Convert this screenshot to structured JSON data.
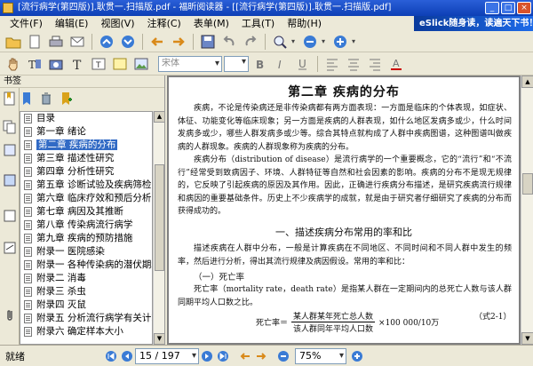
{
  "window": {
    "title": "[流行病学(第四版)].耿贯一.扫描版.pdf - 福昕阅读器 - [[流行病学(第四版)].耿贯一.扫描版.pdf]",
    "controls": [
      "_",
      "□",
      "×"
    ]
  },
  "menu": {
    "items": [
      "文件(F)",
      "编辑(E)",
      "视图(V)",
      "注释(C)",
      "表单(M)",
      "工具(T)",
      "帮助(H)"
    ],
    "banner": "eSlick随身读，读遍天下书！"
  },
  "toolbar": {
    "font_placeholder": "宋体",
    "size_value": ""
  },
  "sidebar": {
    "title": "书签",
    "bookmarks": [
      {
        "label": "目录"
      },
      {
        "label": "第一章 绪论"
      },
      {
        "label": "第二章 疾病的分布",
        "selected": true
      },
      {
        "label": "第三章 描述性研究"
      },
      {
        "label": "第四章 分析性研究"
      },
      {
        "label": "第五章 诊断试验及疾病筛检"
      },
      {
        "label": "第六章 临床疗效和预后分析"
      },
      {
        "label": "第七章 病因及其推断"
      },
      {
        "label": "第八章 传染病流行病学"
      },
      {
        "label": "第九章 疾病的预防措施"
      },
      {
        "label": "附录一 医院感染"
      },
      {
        "label": "附录一 各种传染病的潜伏期和隔离期"
      },
      {
        "label": "附录二 消毒"
      },
      {
        "label": "附录三 杀虫"
      },
      {
        "label": "附录四 灭鼠"
      },
      {
        "label": "附录五 分析流行病学有关计算"
      },
      {
        "label": "附录六 确定样本大小"
      }
    ]
  },
  "document": {
    "chapter_title": "第二章 疾病的分布",
    "para1": "疾病，不论是传染病还是非传染病都有两方面表现：一方面是临床的个体表现，如症状、体征、功能变化等临床现象；另一方面是疾病的人群表现，如什么地区发病多或少，什么时间发病多或少，哪些人群发病多或少等。综合其特点就构成了人群中疾病图谱，这种图谱叫做疾病的人群现象。疾病的人群现象称为疾病的分布。",
    "para2": "疾病分布（distribution of disease）是流行病学的一个重要概念，它的“流行”和“不流行”经常受到致病因子、环境、人群特征等自然和社会因素的影响。疾病的分布不是现无规律的，它反映了引起疾病的原因及其作用。因此，正确进行疾病分布描述，是研究疾病流行规律和病因的重要基础条件。历史上不少疾病学的成就，就是由于研究者仔细研究了疾病的分布而获得成功的。",
    "section_title": "一、描述疾病分布常用的率和比",
    "para3": "描述疾病在人群中分布，一般是计算疾病在不同地区、不同时间和不同人群中发生的频率，然后进行分析，得出其流行规律及病因假设。常用的率和比：",
    "sub_title": "（一）死亡率",
    "para4": "死亡率（mortality rate，death rate）是指某人群在一定期间内的总死亡人数与该人群同期平均人口数之比。",
    "formula": {
      "lhs": "死亡率＝",
      "numerator": "某人群某年死亡总人数",
      "denominator": "该人群同年平均人口数",
      "factor": "×100 000/10万",
      "label": "（式2-1）"
    }
  },
  "status": {
    "ready": "就绪",
    "page": "15 / 197",
    "zoom": "75%"
  },
  "colors": {
    "title_bar": "#0d3fb5",
    "selection": "#316ac5",
    "chrome": "#ece9d8"
  }
}
